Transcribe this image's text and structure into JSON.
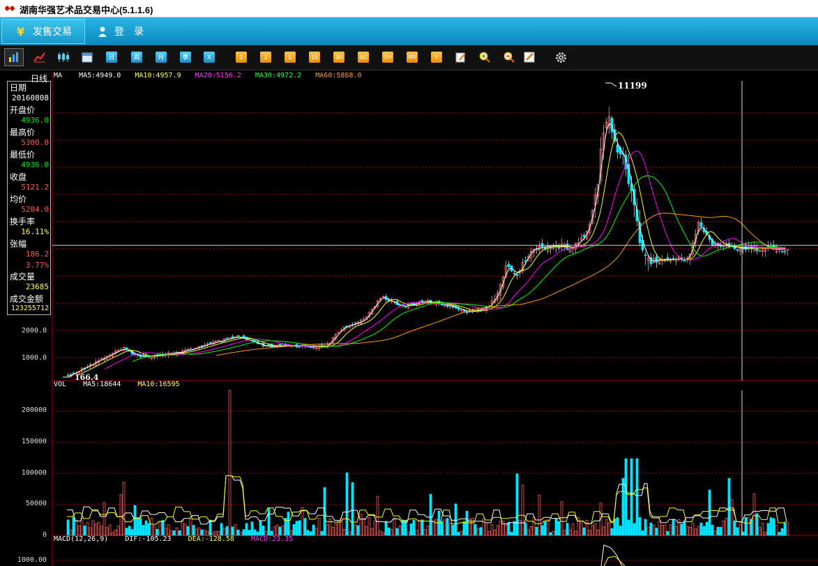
{
  "window": {
    "title": "湖南华强艺术品交易中心(5.1.1.6)"
  },
  "nav": {
    "tab_trade": "发售交易",
    "tab_login": "登　录"
  },
  "toolbar": {
    "buttons": [
      "bar-chart",
      "line-chart",
      "candles",
      "calendar",
      "日",
      "周",
      "月",
      "季",
      "X",
      "1",
      "3",
      "5",
      "15",
      "30",
      "60",
      "2hr",
      "4hr",
      "Y",
      "edit",
      "zoom-in",
      "zoom-out",
      "draw",
      "settings"
    ]
  },
  "chart_header": {
    "period": "日线",
    "ma_title": "MA",
    "ma5": "MA5:4949.0",
    "ma10": "MA10:4957.9",
    "ma20": "MA20:5156.2",
    "ma30": "MA30:4972.2",
    "ma60": "MA60:5868.0"
  },
  "info_panel": {
    "date_label": "日期",
    "date_value": "20160808",
    "open_label": "开盘价",
    "open_value": "4936.0",
    "high_label": "最高价",
    "high_value": "5300.0",
    "low_label": "最低价",
    "low_value": "4936.0",
    "close_label": "收盘",
    "close_value": "5121.2",
    "avg_label": "均价",
    "avg_value": "5204.0",
    "turnover_label": "换手率",
    "turnover_value": "16.11%",
    "change_label": "张幅",
    "change_value": "186.2",
    "change_pct": "3.77%",
    "volume_label": "成交量",
    "volume_value": "23685",
    "amount_label": "成交金额",
    "amount_value": "123255712"
  },
  "price_axis": {
    "ticks": [
      "2000.0",
      "1000.0"
    ],
    "high_marker": "11199",
    "low_marker": "166.4"
  },
  "volume_header": {
    "title": "VOL",
    "ma5": "MA5:18644",
    "ma10": "MA10:16595"
  },
  "volume_axis": {
    "ticks": [
      "200000",
      "150000",
      "100000",
      "50000",
      "0"
    ]
  },
  "macd_header": {
    "title": "MACD(12,26,9)",
    "dif": "DIF:-105.23",
    "dea": "DEA:-128.58",
    "macd": "MACD:23.35"
  },
  "macd_axis": {
    "ticks": [
      "1000.00"
    ]
  },
  "colors": {
    "ma5": "#ffffff",
    "ma10": "#ffff00",
    "ma20": "#ff00ff",
    "ma30": "#00ff00",
    "ma60": "#ff9900",
    "up": "#ff5c5c",
    "down": "#00e5ff",
    "grid": "#8b0000"
  }
}
